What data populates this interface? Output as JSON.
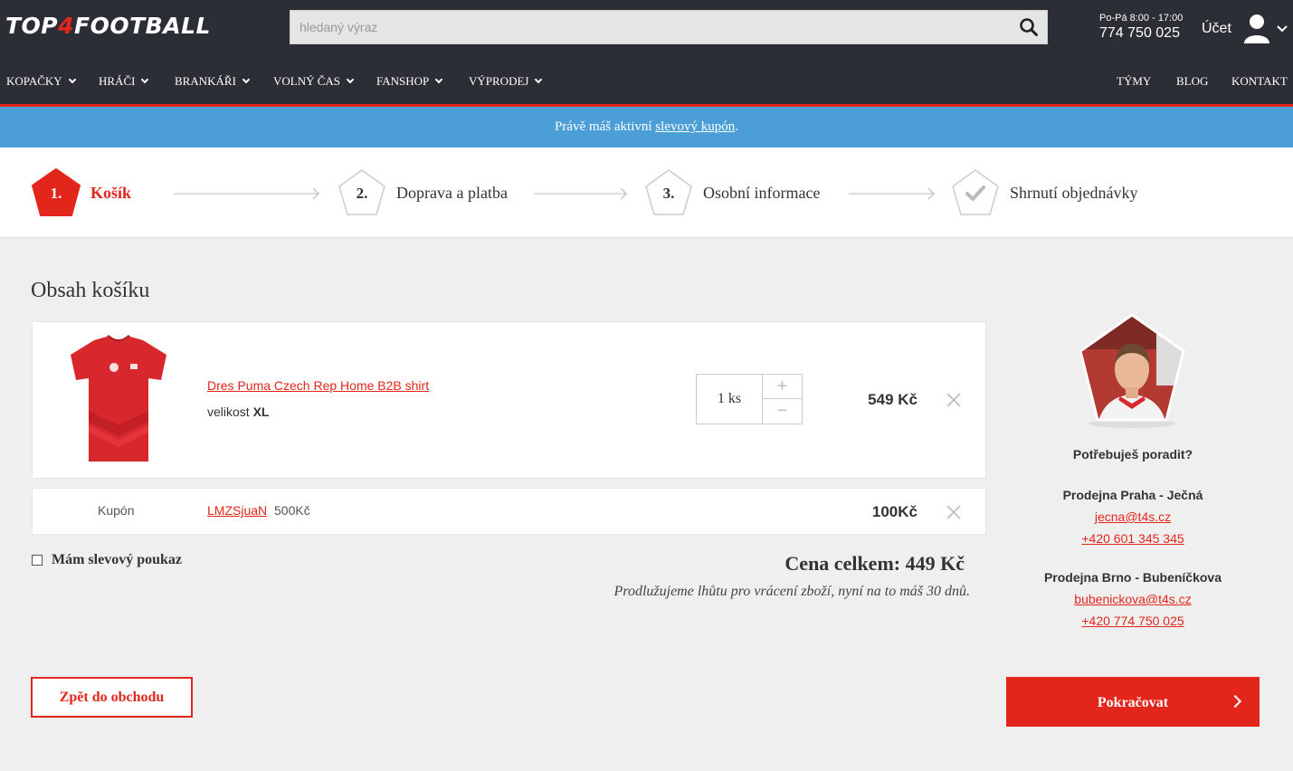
{
  "header": {
    "logo_left": "TOP",
    "logo_four": "4",
    "logo_right": "FOOTBALL",
    "search_placeholder": "hledaný výraz",
    "hours": "Po-Pá 8:00 - 17:00",
    "phone": "774 750 025",
    "account_label": "Účet"
  },
  "nav": {
    "left": [
      "KOPAČKY",
      "HRÁČI",
      "BRANKÁŘI",
      "VOLNÝ ČAS",
      "FANSHOP",
      "VÝPRODEJ"
    ],
    "right": [
      "TÝMY",
      "BLOG",
      "KONTAKT"
    ]
  },
  "banner": {
    "prefix": "Právě máš aktivní",
    "link": "slevový kupón",
    "suffix": "."
  },
  "steps": [
    {
      "number": "1.",
      "label": "Košík"
    },
    {
      "number": "2.",
      "label": "Doprava a platba"
    },
    {
      "number": "3.",
      "label": "Osobní informace"
    },
    {
      "number": "",
      "label": "Shrnutí objednávky"
    }
  ],
  "cart": {
    "title": "Obsah košíku",
    "item": {
      "name": "Dres Puma Czech Rep Home B2B shirt",
      "size_label": "velikost",
      "size": "XL",
      "qty": "1 ks",
      "price": "549 Kč"
    },
    "coupon": {
      "label": "Kupón",
      "code": "LMZSjuaN",
      "amount": "500Kč",
      "price": "100Kč"
    },
    "voucher_label": "Mám slevový poukaz",
    "total_label": "Cena celkem:",
    "total_value": "449 Kč",
    "note": "Prodlužujeme lhůtu pro vrácení zboží, nyní na to máš 30 dnů.",
    "back_label": "Zpět do obchodu",
    "continue_label": "Pokračovat"
  },
  "sidebar": {
    "help_title": "Potřebuješ poradit?",
    "stores": [
      {
        "name": "Prodejna Praha - Ječná",
        "email": "jecna@t4s.cz",
        "phone": "+420 601 345 345"
      },
      {
        "name": "Prodejna Brno - Bubeníčkova",
        "email": "bubenickova@t4s.cz",
        "phone": "+420 774 750 025"
      }
    ]
  },
  "colors": {
    "brand_red": "#e3261b",
    "header_dark": "#2b2e35",
    "banner_blue": "#4b9fd6"
  }
}
